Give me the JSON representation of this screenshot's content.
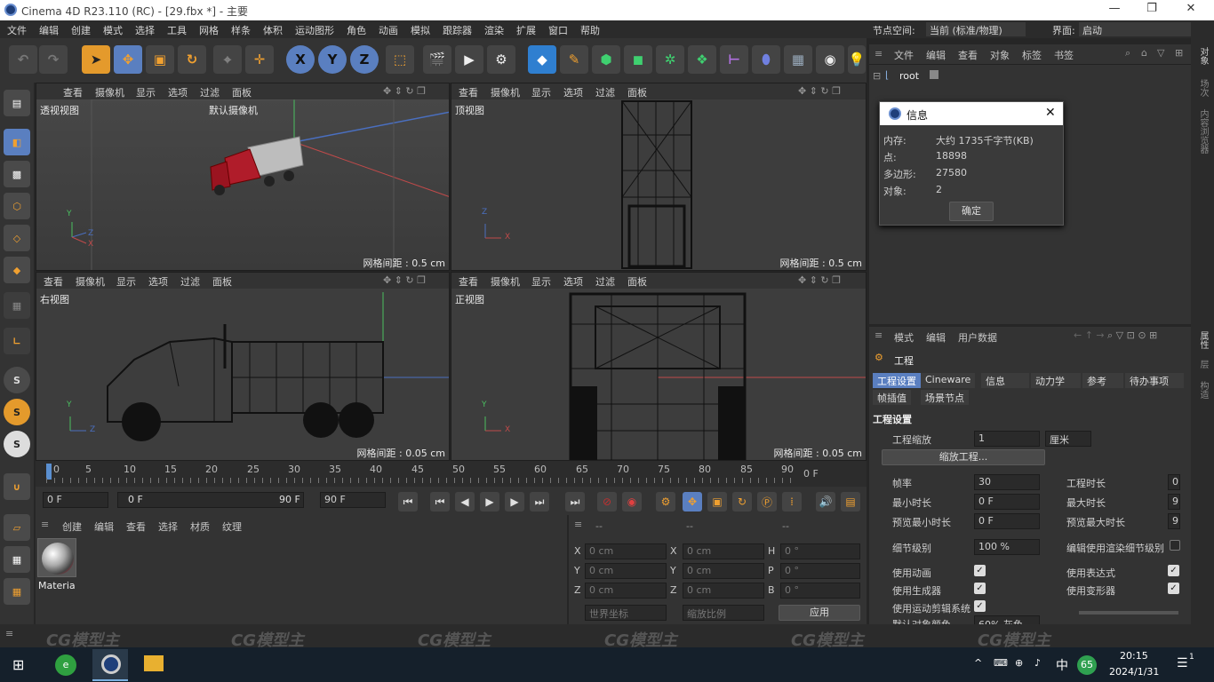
{
  "window": {
    "title": "Cinema 4D R23.110 (RC) - [29.fbx *] - 主要",
    "min": "—",
    "max": "❐",
    "close": "✕"
  },
  "menu": [
    "文件",
    "编辑",
    "创建",
    "模式",
    "选择",
    "工具",
    "网格",
    "样条",
    "体积",
    "运动图形",
    "角色",
    "动画",
    "模拟",
    "跟踪器",
    "渲染",
    "扩展",
    "窗口",
    "帮助"
  ],
  "node_space": {
    "label": "节点空间:",
    "value": "当前 (标准/物理)"
  },
  "layout": {
    "label": "界面:",
    "value": "启动"
  },
  "toolbar_axis": [
    "X",
    "Y",
    "Z"
  ],
  "viewport_menu": [
    "查看",
    "摄像机",
    "显示",
    "选项",
    "过滤",
    "面板"
  ],
  "viewports": [
    {
      "name": "透视视图",
      "camera": "默认摄像机",
      "grid": "网格间距 : 0.5 cm"
    },
    {
      "name": "顶视图",
      "grid": "网格间距 : 0.5 cm"
    },
    {
      "name": "右视图",
      "grid": "网格间距 : 0.05 cm"
    },
    {
      "name": "正视图",
      "grid": "网格间距 : 0.05 cm"
    }
  ],
  "timeline_ticks": [
    "0",
    "5",
    "10",
    "15",
    "20",
    "25",
    "30",
    "35",
    "40",
    "45",
    "50",
    "55",
    "60",
    "65",
    "70",
    "75",
    "80",
    "85",
    "90"
  ],
  "timeline_end": "0 F",
  "transport": {
    "start": "0 F",
    "current": "0 F",
    "end_inner": "90 F",
    "end": "90 F"
  },
  "mat_menu": [
    "创建",
    "编辑",
    "查看",
    "选择",
    "材质",
    "纹理"
  ],
  "material": {
    "name": "Materia"
  },
  "coords": {
    "header": [
      "--",
      "--",
      "--"
    ],
    "rows": [
      {
        "a": "X",
        "av": "0 cm",
        "b": "X",
        "bv": "0 cm",
        "c": "H",
        "cv": "0 °"
      },
      {
        "a": "Y",
        "av": "0 cm",
        "b": "Y",
        "bv": "0 cm",
        "c": "P",
        "cv": "0 °"
      },
      {
        "a": "Z",
        "av": "0 cm",
        "b": "Z",
        "bv": "0 cm",
        "c": "B",
        "cv": "0 °"
      }
    ],
    "world": "世界坐标",
    "scale": "缩放比例",
    "apply": "应用"
  },
  "obj_menu": [
    "文件",
    "编辑",
    "查看",
    "对象",
    "标签",
    "书签"
  ],
  "obj_root": "root",
  "dialog": {
    "title": "信息",
    "rows": [
      {
        "k": "内存:",
        "v": "大约 1735千字节(KB)"
      },
      {
        "k": "点:",
        "v": "18898"
      },
      {
        "k": "多边形:",
        "v": "27580"
      },
      {
        "k": "对象:",
        "v": "2"
      }
    ],
    "ok": "确定"
  },
  "attr_menu": [
    "模式",
    "编辑",
    "用户数据"
  ],
  "attr_title": "工程",
  "attr_tabs": [
    "工程设置",
    "Cineware",
    "信息",
    "动力学",
    "参考",
    "待办事项"
  ],
  "attr_tabs2": [
    "帧插值",
    "场景节点"
  ],
  "attr_section": "工程设置",
  "attr": {
    "scale_label": "工程缩放",
    "scale_value": "1",
    "scale_unit": "厘米",
    "scale_btn": "缩放工程...",
    "fps_label": "帧率",
    "fps_value": "30",
    "dur_label": "工程时长",
    "dur_value": "0",
    "min_label": "最小时长",
    "min_value": "0 F",
    "max_label": "最大时长",
    "max_value": "9",
    "pmin_label": "预览最小时长",
    "pmin_value": "0 F",
    "pmax_label": "预览最大时长",
    "pmax_value": "9",
    "lod_label": "细节级别",
    "lod_value": "100 %",
    "lod_render": "编辑使用渲染细节级别",
    "anim": "使用动画",
    "expr": "使用表达式",
    "gen": "使用生成器",
    "deform": "使用变形器",
    "motion": "使用运动剪辑系统",
    "color_label": "默认对象颜色",
    "color_value": "60% 灰色"
  },
  "right_strip": [
    "对象",
    "场次",
    "内容浏览器",
    "属性",
    "层",
    "构造"
  ],
  "taskbar": {
    "badge": "65",
    "ime": "中",
    "time": "20:15",
    "date": "2024/1/31",
    "notif": "1"
  },
  "watermark": "CG模型主"
}
